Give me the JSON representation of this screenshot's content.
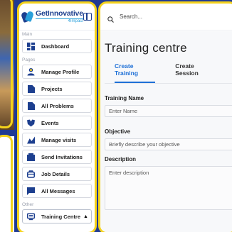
{
  "logo": {
    "title": "GetInnovative",
    "subtitle": "4Impact"
  },
  "sidebar": {
    "sections": {
      "main": "Main",
      "pages": "Pages",
      "other": "Other"
    },
    "main_items": [
      {
        "label": "Dashboard",
        "icon": "dashboard-icon"
      }
    ],
    "page_items": [
      {
        "label": "Manage Profile",
        "icon": "user-icon"
      },
      {
        "label": "Projects",
        "icon": "file-icon"
      },
      {
        "label": "All Problems",
        "icon": "file-icon"
      },
      {
        "label": "Events",
        "icon": "handshake-icon"
      },
      {
        "label": "Manage visits",
        "icon": "chart-icon"
      },
      {
        "label": "Send Invitations",
        "icon": "envelope-icon"
      },
      {
        "label": "Job Details",
        "icon": "briefcase-icon"
      },
      {
        "label": "All Messages",
        "icon": "message-icon"
      }
    ],
    "other_items": [
      {
        "label": "Training Centre",
        "icon": "monitor-icon",
        "expanded": true
      }
    ]
  },
  "search": {
    "placeholder": "Search..."
  },
  "page": {
    "title": "Training centre",
    "tabs": [
      {
        "label": "Create Training",
        "active": true
      },
      {
        "label": "Create Session",
        "active": false
      }
    ]
  },
  "form": {
    "name_label": "Training Name",
    "name_placeholder": "Enter Name",
    "objective_label": "Objective",
    "objective_placeholder": "Briefly describe your objective",
    "description_label": "Description",
    "description_placeholder": "Enter description"
  },
  "colors": {
    "accent": "#1d6fd6",
    "frame": "#f4d21c",
    "brand": "#1d3f8f"
  }
}
